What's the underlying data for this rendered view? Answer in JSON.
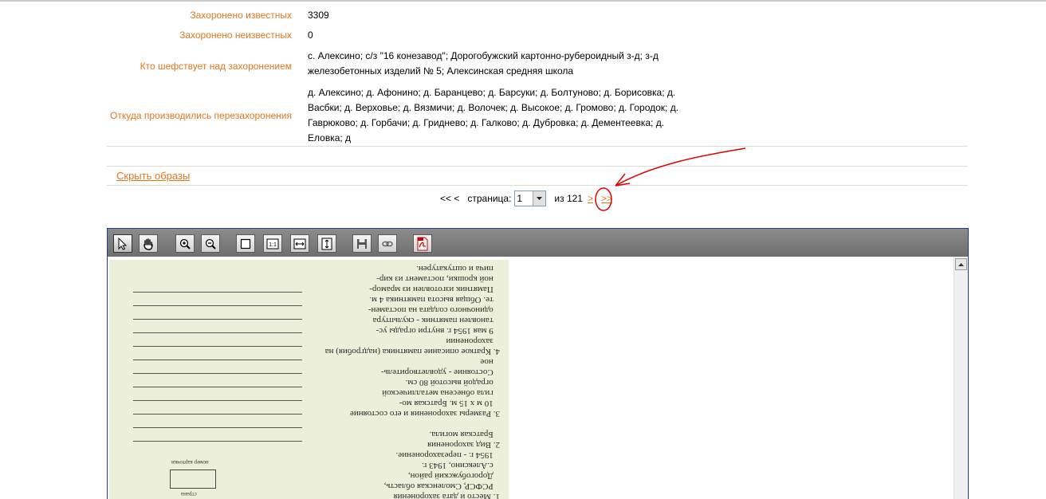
{
  "info_rows": [
    {
      "label": "Захоронено известных",
      "value": "3309"
    },
    {
      "label": "Захоронено неизвестных",
      "value": "0"
    },
    {
      "label": "Кто шефствует над захоронением",
      "value": "с. Алексино; с/з \"16 конезавод\"; Дорогобужский картонно-рубероидный з-д; з-д железобетонных изделий № 5; Алексинская средняя школа"
    },
    {
      "label": "Откуда производились перезахоронения",
      "value": "д. Алексино; д. Афонино; д. Баранцево; д. Барсуки; д. Болтуново; д. Борисовка; д. Васбки; д. Верховье; д. Вязмичи; д. Волочек; д. Высокое; д. Громово; д. Городок; д. Гаврюково; д. Горбачи; д. Гриднево; д. Галково; д. Дубровка; д. Дементеевка; д. Еловка; д"
    }
  ],
  "hide_images_link": "Скрыть образы",
  "pager": {
    "first_prev": "<< <",
    "page_label": "страница:",
    "current_page": "1",
    "of_label": "из 121",
    "next": ">",
    "last": ">>"
  },
  "scan_text": "1. Место и дата захоронения\n   РСФСР, Смоленская область,\n   Дорогобужский район,\n   с.Алексино, 1943 г.\n   1954 г. - перезахоронение.\n2. Вид захоронения\n   Братская могила.\n\n3. Размеры захоронения и его состояние\n   10 м х 15 м. Братская мо-\n   гила обнесена металлической\n   оградой высотой 80 см.\n   Состояние - удовлетворитель-\n   ное\n4. Краткое описание памятника (надгробия) на\n   захоронении\n   9 мая 1954 г. внутри ограды ус-\n   тановлен памятник - скульптура\n   одиночного солдата на постамен-\n   те. Общая высота памятника 4 м.\n   Памятник изготовлен из мрамор-\n   ной крошки, постамент из кир-\n   пича и оштукатурен.",
  "scan_small_labels": {
    "card_number": "номер карточки",
    "country": "страна"
  },
  "colors": {
    "label_orange": "#e2761d",
    "viewer_border": "#243d9a",
    "annotation_red": "#e00000"
  }
}
